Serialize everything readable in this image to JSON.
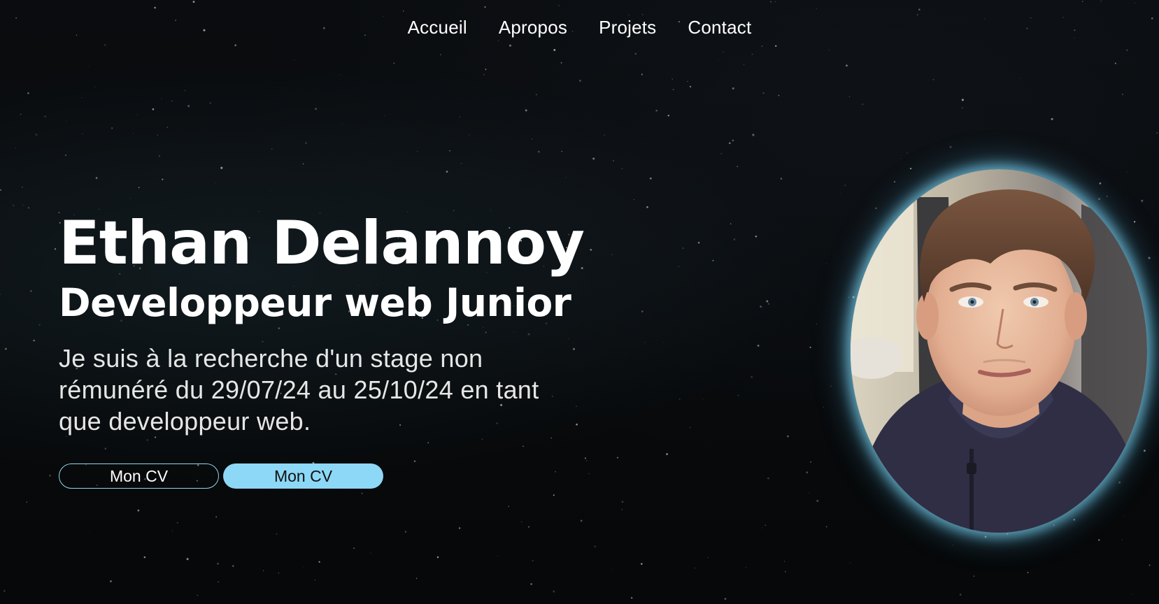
{
  "nav": {
    "items": [
      {
        "label": "Accueil"
      },
      {
        "label": "Apropos"
      },
      {
        "label": "Projets"
      },
      {
        "label": "Contact"
      }
    ]
  },
  "hero": {
    "name": "Ethan Delannoy",
    "role": "Developpeur web Junior",
    "description": "Je suis à la recherche d'un stage non rémunéré du 29/07/24 au 25/10/24 en tant que developpeur web.",
    "buttons": {
      "cv_outline_label": "Mon CV",
      "cv_filled_label": "Mon CV"
    }
  },
  "colors": {
    "accent": "#8dd8f6",
    "background": "#07090b",
    "text": "#ffffff"
  }
}
